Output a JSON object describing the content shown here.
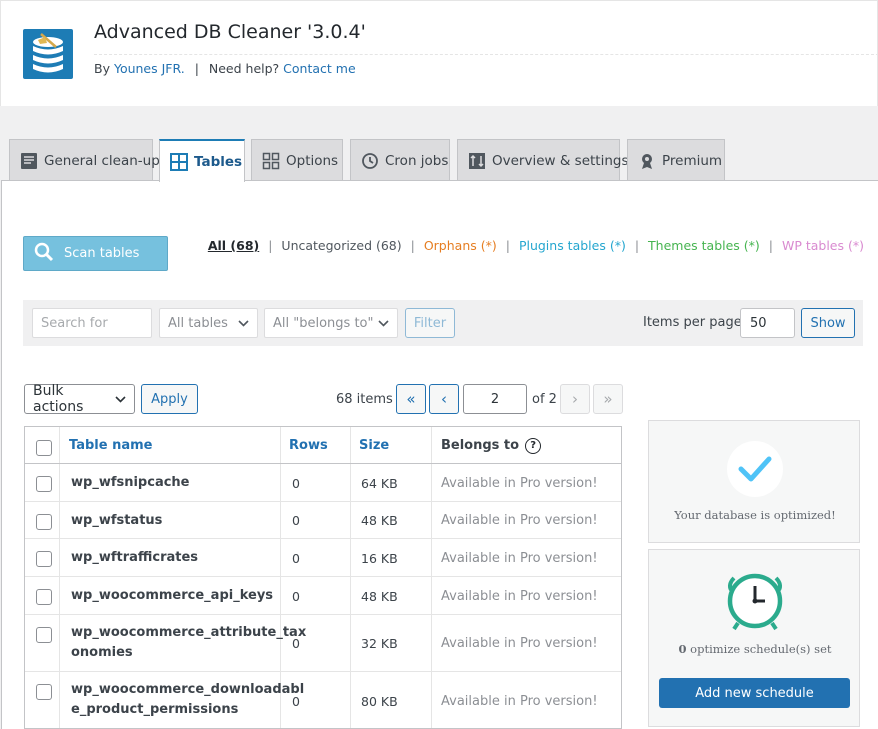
{
  "app": {
    "title": "Advanced DB Cleaner '3.0.4'",
    "by_label": "By",
    "author": "Younes JFR.",
    "separator": "|",
    "help_label": "Need help?",
    "contact": "Contact me"
  },
  "tabs": [
    {
      "label": "General clean-up",
      "icon": "document-icon",
      "active": false
    },
    {
      "label": "Tables",
      "icon": "grid-icon",
      "active": true
    },
    {
      "label": "Options",
      "icon": "options-icon",
      "active": false
    },
    {
      "label": "Cron jobs",
      "icon": "history-icon",
      "active": false
    },
    {
      "label": "Overview & settings",
      "icon": "sort-icon",
      "active": false
    },
    {
      "label": "Premium",
      "icon": "award-icon",
      "active": false
    }
  ],
  "scan": {
    "label": "Scan tables",
    "icon": "search-icon"
  },
  "filter_links": {
    "all": "All (68)",
    "uncategorized": "Uncategorized (68)",
    "orphans": "Orphans (*)",
    "plugins": "Plugins tables (*)",
    "themes": "Themes tables (*)",
    "wp": "WP tables (*)",
    "separator": "|"
  },
  "filter_bar": {
    "search_placeholder": "Search for",
    "tables_select": "All tables",
    "belongs_select": "All \"belongs to\"",
    "filter_button": "Filter",
    "items_per_page_label": "Items per page",
    "items_per_page_value": "50",
    "show_button": "Show"
  },
  "toolbar": {
    "bulk_actions": "Bulk actions",
    "apply": "Apply",
    "items_count": "68 items",
    "first": "«",
    "prev": "‹",
    "page": "2",
    "of": "of 2",
    "next": "›",
    "last": "»"
  },
  "table": {
    "headers": {
      "name": "Table name",
      "rows": "Rows",
      "size": "Size",
      "belongs": "Belongs to",
      "help_glyph": "?"
    },
    "rows": [
      {
        "name": "wp_wfsnipcache",
        "rows": "0",
        "size": "64 KB",
        "belongs": "Available in Pro version!"
      },
      {
        "name": "wp_wfstatus",
        "rows": "0",
        "size": "48 KB",
        "belongs": "Available in Pro version!"
      },
      {
        "name": "wp_wftrafficrates",
        "rows": "0",
        "size": "16 KB",
        "belongs": "Available in Pro version!"
      },
      {
        "name": "wp_woocommerce_api_keys",
        "rows": "0",
        "size": "48 KB",
        "belongs": "Available in Pro version!"
      },
      {
        "name_line1": "wp_woocommerce_attribute_tax",
        "name_line2": "onomies",
        "rows": "0",
        "size": "32 KB",
        "belongs": "Available in Pro version!"
      },
      {
        "name_line1": "wp_woocommerce_downloadabl",
        "name_line2": "e_product_permissions",
        "rows": "0",
        "size": "80 KB",
        "belongs": "Available in Pro version!"
      }
    ]
  },
  "side": {
    "optimized_text": "Your database is optimized!",
    "schedule_count": "0",
    "schedule_text": "optimize schedule(s) set",
    "add_schedule": "Add new schedule",
    "check_color": "#4fc3f7",
    "clock_color": "#2bab8d"
  },
  "colors": {
    "accent": "#2271b1",
    "scan_button": "#76c1de"
  }
}
